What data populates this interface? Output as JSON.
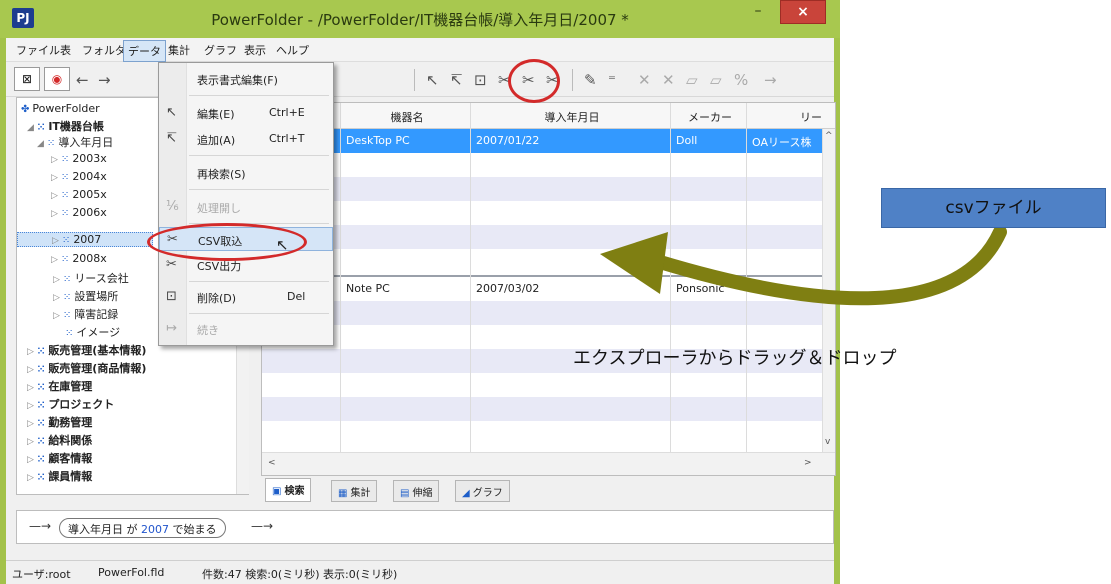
{
  "window": {
    "title": "PowerFolder - /PowerFolder/IT機器台帳/導入年月日/2007 *",
    "logo": "PJ",
    "min_glyph": "–",
    "max_glyph": "□",
    "close_glyph": "×"
  },
  "menubar": [
    "ファイル",
    "表",
    "フォルダ",
    "データ",
    "集計",
    "グラフ",
    "表示",
    "ヘルプ"
  ],
  "data_menu": {
    "items": [
      {
        "label": "表示書式編集(F)",
        "shortcut": "",
        "icon": "",
        "disabled": false
      },
      {
        "label": "編集(E)",
        "shortcut": "Ctrl+E",
        "icon": "edit-icon",
        "disabled": false
      },
      {
        "label": "追加(A)",
        "shortcut": "Ctrl+T",
        "icon": "add-icon",
        "disabled": false
      },
      {
        "label": "再検索(S)",
        "shortcut": "",
        "icon": "",
        "disabled": false
      },
      {
        "label": "処理開し",
        "shortcut": "",
        "icon": "process-icon",
        "disabled": true
      },
      {
        "label": "CSV取込",
        "shortcut": "",
        "icon": "csv-import-icon",
        "disabled": false
      },
      {
        "label": "CSV出力",
        "shortcut": "",
        "icon": "csv-export-icon",
        "disabled": false
      },
      {
        "label": "削除(D)",
        "shortcut": "Del",
        "icon": "delete-icon",
        "disabled": false
      },
      {
        "label": "続き",
        "shortcut": "",
        "icon": "continue-icon",
        "disabled": true
      }
    ]
  },
  "tree": {
    "root": "PowerFolder",
    "nodes": [
      {
        "label": "IT機器台帳",
        "level": 1,
        "bold": true
      },
      {
        "label": "導入年月日",
        "level": 2,
        "bold": false
      },
      {
        "label": "2003x",
        "level": 3,
        "bold": false
      },
      {
        "label": "2004x",
        "level": 3,
        "bold": false
      },
      {
        "label": "2005x",
        "level": 3,
        "bold": false
      },
      {
        "label": "2006x",
        "level": 3,
        "bold": false
      },
      {
        "label": "2007",
        "level": 3,
        "bold": false,
        "selected": true
      },
      {
        "label": "2008x",
        "level": 3,
        "bold": false
      },
      {
        "label": "リース会社",
        "level": 2,
        "bold": false
      },
      {
        "label": "設置場所",
        "level": 2,
        "bold": false
      },
      {
        "label": "障害記録",
        "level": 2,
        "bold": false
      },
      {
        "label": "イメージ",
        "level": 2,
        "bold": false
      },
      {
        "label": "販売管理(基本情報)",
        "level": 0,
        "bold": true
      },
      {
        "label": "販売管理(商品情報)",
        "level": 0,
        "bold": true
      },
      {
        "label": "在庫管理",
        "level": 0,
        "bold": true
      },
      {
        "label": "プロジェクト",
        "level": 0,
        "bold": true
      },
      {
        "label": "勤務管理",
        "level": 0,
        "bold": true
      },
      {
        "label": "給料関係",
        "level": 0,
        "bold": true
      },
      {
        "label": "顧客情報",
        "level": 0,
        "bold": true
      },
      {
        "label": "課員情報",
        "level": 0,
        "bold": true
      }
    ]
  },
  "grid": {
    "columns": [
      "機器名",
      "導入年月日",
      "メーカー",
      "リー"
    ],
    "rows": [
      {
        "name": "DeskTop PC",
        "date": "2007/01/22",
        "maker": "Doll",
        "lease": "OAリース株"
      },
      {
        "name": "Note PC",
        "date": "2007/03/02",
        "maker": "Ponsonic",
        "lease": ""
      }
    ]
  },
  "tabs": [
    {
      "label": "検索",
      "active": true
    },
    {
      "label": "集計",
      "active": false
    },
    {
      "label": "伸縮",
      "active": false
    },
    {
      "label": "グラフ",
      "active": false
    }
  ],
  "filter": {
    "field": "導入年月日",
    "op1": "が",
    "value": "2007",
    "op2": "で始まる"
  },
  "status": {
    "user": "ユーザ:root",
    "file": "PowerFol.fld",
    "info": "件数:47  検索:0(ミリ秒)  表示:0(ミリ秒)"
  },
  "annotation": {
    "csv_label": "csvファイル",
    "drop_text": "エクスプローラからドラッグ＆ドロップ"
  },
  "colors": {
    "title_green": "#a8c84f",
    "close_red": "#c9443a",
    "selection_blue": "#3399ff",
    "callout_blue": "#4f81c6",
    "arrow_olive": "#7f7f12",
    "ring_red": "#d32a2a"
  }
}
